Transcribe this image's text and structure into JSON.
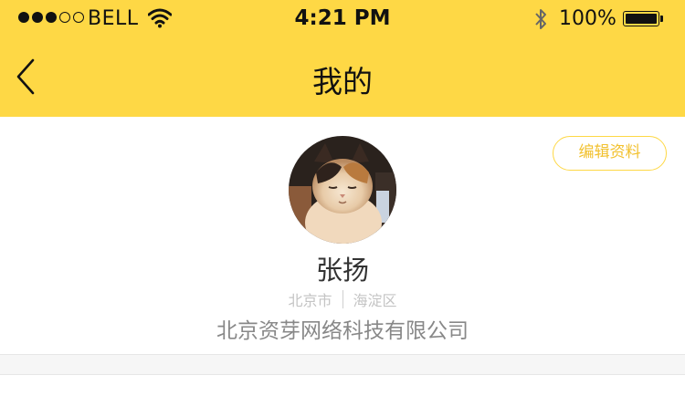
{
  "status_bar": {
    "signal_dots": [
      "full",
      "full",
      "full",
      "empty",
      "empty"
    ],
    "carrier": "BELL",
    "time": "4:21 PM",
    "battery_percent": "100%",
    "battery_level": 1.0,
    "icons": [
      "wifi-icon",
      "bluetooth-icon",
      "battery-icon"
    ]
  },
  "nav": {
    "title": "我的",
    "back_icon": "chevron-left-icon"
  },
  "profile": {
    "edit_label": "编辑资料",
    "avatar_icon": "cat-photo-avatar",
    "name": "张扬",
    "city": "北京市",
    "district": "海淀区",
    "company": "北京资芽网络科技有限公司"
  },
  "colors": {
    "brand_yellow": "#FED845",
    "edit_text": "#F2C12E"
  }
}
